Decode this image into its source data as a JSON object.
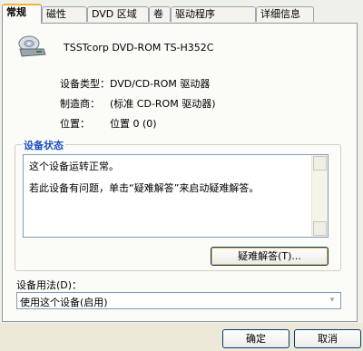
{
  "tabs": [
    "常规",
    "磁性",
    "DVD 区域",
    "卷",
    "驱动程序",
    "详细信息"
  ],
  "device": {
    "name": "TSSTcorp DVD-ROM TS-H352C"
  },
  "properties": [
    {
      "label": "设备类型：",
      "value": "DVD/CD-ROM 驱动器"
    },
    {
      "label": "制造商：",
      "value": "(标准 CD-ROM 驱动器)"
    },
    {
      "label": "位置：",
      "value": "位置 0 (0)"
    }
  ],
  "status_group": {
    "title": "设备状态",
    "lines": [
      "这个设备运转正常。",
      "若此设备有问题，单击“疑难解答”来启动疑难解答。"
    ],
    "troubleshoot_button": "疑难解答(T)..."
  },
  "usage": {
    "label": "设备用法(D)：",
    "selected": "使用这个设备(启用)"
  },
  "footer": {
    "ok": "确定",
    "cancel": "取消"
  }
}
